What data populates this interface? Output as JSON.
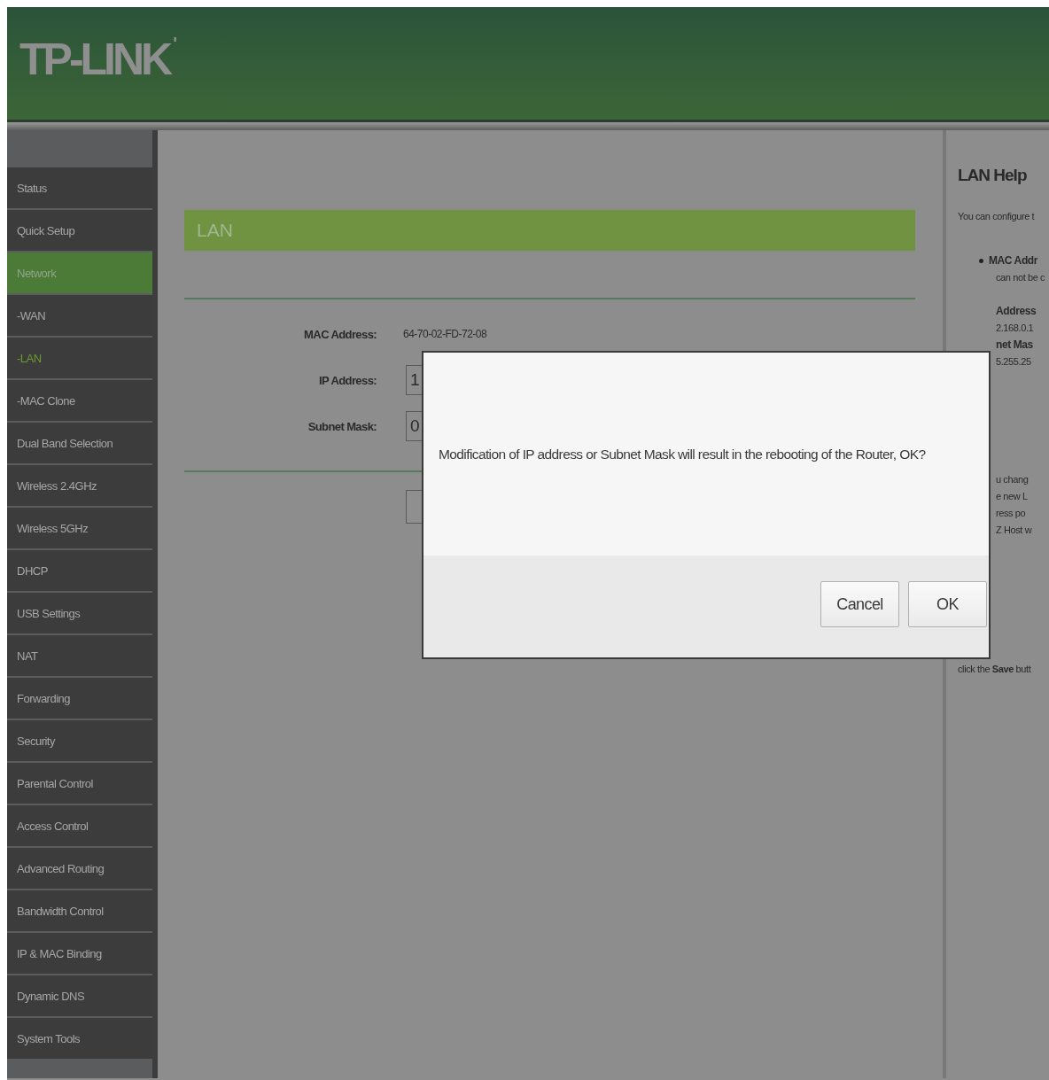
{
  "header": {
    "logo": "TP-LINK",
    "logo_mark": "'"
  },
  "sidebar": {
    "items": [
      {
        "label": "Status",
        "kind": "main",
        "selected": false
      },
      {
        "label": "Quick Setup",
        "kind": "main",
        "selected": false
      },
      {
        "label": "Network",
        "kind": "main",
        "selected": true
      },
      {
        "label": "-WAN",
        "kind": "sub",
        "selected": false
      },
      {
        "label": "-LAN",
        "kind": "sub",
        "selected": true
      },
      {
        "label": "-MAC Clone",
        "kind": "sub",
        "selected": false
      },
      {
        "label": "Dual Band Selection",
        "kind": "main",
        "selected": false
      },
      {
        "label": "Wireless 2.4GHz",
        "kind": "main",
        "selected": false
      },
      {
        "label": "Wireless 5GHz",
        "kind": "main",
        "selected": false
      },
      {
        "label": "DHCP",
        "kind": "main",
        "selected": false
      },
      {
        "label": "USB Settings",
        "kind": "main",
        "selected": false
      },
      {
        "label": "NAT",
        "kind": "main",
        "selected": false
      },
      {
        "label": "Forwarding",
        "kind": "main",
        "selected": false
      },
      {
        "label": "Security",
        "kind": "main",
        "selected": false
      },
      {
        "label": "Parental Control",
        "kind": "main",
        "selected": false
      },
      {
        "label": "Access Control",
        "kind": "main",
        "selected": false
      },
      {
        "label": "Advanced Routing",
        "kind": "main",
        "selected": false
      },
      {
        "label": "Bandwidth Control",
        "kind": "main",
        "selected": false
      },
      {
        "label": "IP & MAC Binding",
        "kind": "main",
        "selected": false
      },
      {
        "label": "Dynamic DNS",
        "kind": "main",
        "selected": false
      },
      {
        "label": "System Tools",
        "kind": "main",
        "selected": false
      }
    ]
  },
  "main": {
    "title": "LAN",
    "fields": [
      {
        "label": "MAC Address:",
        "kind": "text",
        "value": "64-70-02-FD-72-08"
      },
      {
        "label": "IP Address:",
        "kind": "input",
        "value": "1"
      },
      {
        "label": "Subnet Mask:",
        "kind": "input",
        "value": "0"
      }
    ]
  },
  "help": {
    "title": "LAN Help",
    "lines": [
      {
        "kind": "intro",
        "text": "You can configure t"
      },
      {
        "kind": "bullet",
        "text": "MAC Addr"
      },
      {
        "kind": "fragment",
        "text": "can not be c"
      },
      {
        "kind": "bold_fragment",
        "text": "Address"
      },
      {
        "kind": "fragment",
        "text": "2.168.0.1"
      },
      {
        "kind": "bold_fragment",
        "text": "net Mas"
      },
      {
        "kind": "fragment",
        "text": "5.255.25"
      },
      {
        "kind": "fragment",
        "text": "u chang"
      },
      {
        "kind": "fragment",
        "text": "e new L"
      },
      {
        "kind": "fragment",
        "text": "ress po"
      },
      {
        "kind": "fragment",
        "text": "Z Host w"
      },
      {
        "kind": "note",
        "text": "click the **Save** butt"
      }
    ]
  },
  "dialog": {
    "message": "Modification of IP address or Subnet Mask will result in the rebooting of the Router, OK?",
    "buttons": [
      "Cancel",
      "OK"
    ]
  }
}
